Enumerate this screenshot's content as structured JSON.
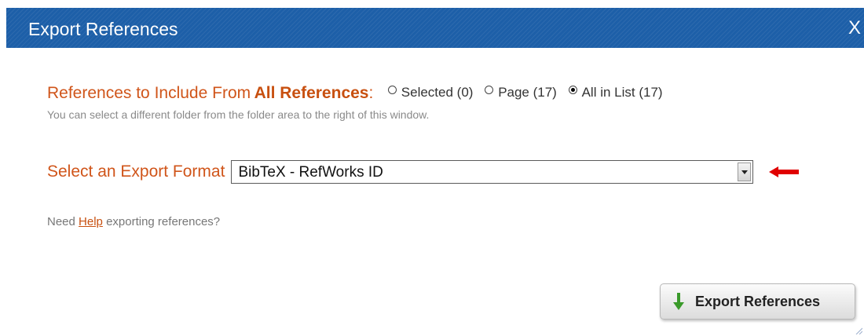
{
  "dialog": {
    "title": "Export References",
    "close_label": "X"
  },
  "include": {
    "label": "References to Include From",
    "folder": "All References",
    "separator": ":",
    "options": [
      {
        "label": "Selected (0)",
        "checked": false
      },
      {
        "label": "Page (17)",
        "checked": false
      },
      {
        "label": "All in List (17)",
        "checked": true
      }
    ],
    "hint": "You can select a different folder from the folder area to the right of this window."
  },
  "format": {
    "label": "Select an Export Format",
    "selected": "BibTeX - RefWorks ID"
  },
  "help": {
    "prefix": "Need",
    "link": "Help",
    "suffix": "exporting references?"
  },
  "export_button": {
    "label": "Export References"
  },
  "colors": {
    "titlebar": "#1d5fa8",
    "label_orange": "#d0551a",
    "arrow_red": "#e00000",
    "download_green": "#3a9a2a"
  }
}
